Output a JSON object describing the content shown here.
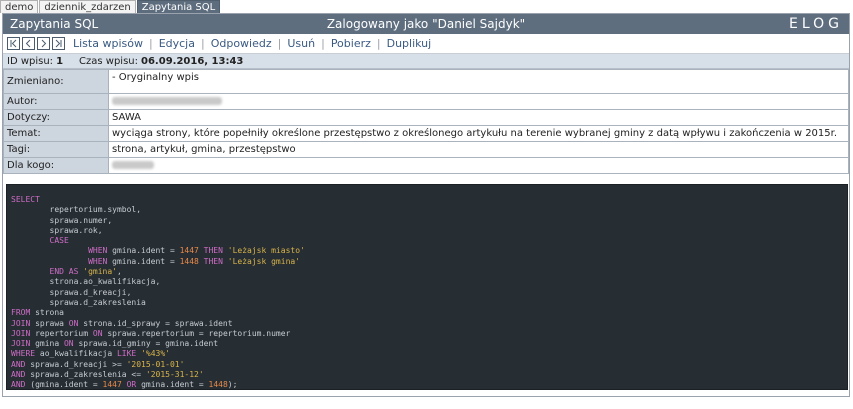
{
  "tabs": [
    {
      "label": "demo",
      "active": false
    },
    {
      "label": "dziennik_zdarzen",
      "active": false
    },
    {
      "label": "Zapytania SQL",
      "active": true
    }
  ],
  "header": {
    "logbook_name": "Zapytania SQL",
    "logged_in": "Zalogowany jako \"Daniel Sajdyk\"",
    "logo": "ELOG"
  },
  "toolbar": {
    "nav_buttons": [
      {
        "name": "first-entry-button",
        "icon": "first-icon"
      },
      {
        "name": "previous-entry-button",
        "icon": "previous-icon"
      },
      {
        "name": "next-entry-button",
        "icon": "next-icon"
      },
      {
        "name": "last-entry-button",
        "icon": "last-icon"
      }
    ],
    "links": [
      "Lista wpisów",
      "Edycja",
      "Odpowiedz",
      "Usuń",
      "Pobierz",
      "Duplikuj"
    ]
  },
  "entry": {
    "id_label": "ID wpisu:",
    "id_value": "1",
    "time_label": "Czas wpisu:",
    "time_value": "06.09.2016, 13:43"
  },
  "attributes": [
    {
      "name": "Zmieniano:",
      "value": "- Oryginalny wpis",
      "redacted": false
    },
    {
      "name": "Autor:",
      "value": "",
      "redacted": true
    },
    {
      "name": "Dotyczy:",
      "value": "SAWA",
      "redacted": false
    },
    {
      "name": "Temat:",
      "value": "wyciąga strony, które popełniły określone przestępstwo z określonego artykułu na terenie wybranej gminy z datą wpływu i zakończenia w 2015r.",
      "redacted": false
    },
    {
      "name": "Tagi:",
      "value": "strona, artykuł, gmina, przestępstwo",
      "redacted": false
    },
    {
      "name": "Dla kogo:",
      "value": "",
      "redacted": true
    }
  ],
  "code": {
    "language": "sql",
    "lines": [
      [
        [
          "kw",
          "SELECT"
        ]
      ],
      [
        [
          "plain",
          "        repertorium.symbol,"
        ]
      ],
      [
        [
          "plain",
          "        sprawa.numer,"
        ]
      ],
      [
        [
          "plain",
          "        sprawa.rok,"
        ]
      ],
      [
        [
          "plain",
          "        "
        ],
        [
          "kw",
          "CASE"
        ]
      ],
      [
        [
          "plain",
          "                "
        ],
        [
          "kw",
          "WHEN"
        ],
        [
          "plain",
          " gmina.ident = "
        ],
        [
          "num",
          "1447"
        ],
        [
          "plain",
          " "
        ],
        [
          "kw",
          "THEN"
        ],
        [
          "plain",
          " "
        ],
        [
          "str",
          "'Leżajsk miasto'"
        ]
      ],
      [
        [
          "plain",
          "                "
        ],
        [
          "kw",
          "WHEN"
        ],
        [
          "plain",
          " gmina.ident = "
        ],
        [
          "num",
          "1448"
        ],
        [
          "plain",
          " "
        ],
        [
          "kw",
          "THEN"
        ],
        [
          "plain",
          " "
        ],
        [
          "str",
          "'Leżajsk gmina'"
        ]
      ],
      [
        [
          "plain",
          "        "
        ],
        [
          "kw",
          "END AS"
        ],
        [
          "plain",
          " "
        ],
        [
          "str",
          "'gmina'"
        ],
        [
          "plain",
          ","
        ]
      ],
      [
        [
          "plain",
          "        strona.ao_kwalifikacja,"
        ]
      ],
      [
        [
          "plain",
          "        sprawa.d_kreacji,"
        ]
      ],
      [
        [
          "plain",
          "        sprawa.d_zakreslenia"
        ]
      ],
      [
        [
          "kw",
          "FROM"
        ],
        [
          "plain",
          " strona"
        ]
      ],
      [
        [
          "kw",
          "JOIN"
        ],
        [
          "plain",
          " sprawa "
        ],
        [
          "kw",
          "ON"
        ],
        [
          "plain",
          " strona.id_sprawy = sprawa.ident"
        ]
      ],
      [
        [
          "kw",
          "JOIN"
        ],
        [
          "plain",
          " repertorium "
        ],
        [
          "kw",
          "ON"
        ],
        [
          "plain",
          " sprawa.repertorium = repertorium.numer"
        ]
      ],
      [
        [
          "kw",
          "JOIN"
        ],
        [
          "plain",
          " gmina "
        ],
        [
          "kw",
          "ON"
        ],
        [
          "plain",
          " sprawa.id_gminy = gmina.ident"
        ]
      ],
      [
        [
          "kw",
          "WHERE"
        ],
        [
          "plain",
          " ao_kwalifikacja "
        ],
        [
          "kw",
          "LIKE"
        ],
        [
          "plain",
          " "
        ],
        [
          "str",
          "'%43%'"
        ]
      ],
      [
        [
          "kw",
          "AND"
        ],
        [
          "plain",
          " sprawa.d_kreacji >= "
        ],
        [
          "str",
          "'2015-01-01'"
        ]
      ],
      [
        [
          "kw",
          "AND"
        ],
        [
          "plain",
          " sprawa.d_zakreslenia <= "
        ],
        [
          "str",
          "'2015-31-12'"
        ]
      ],
      [
        [
          "kw",
          "AND"
        ],
        [
          "plain",
          " (gmina.ident = "
        ],
        [
          "num",
          "1447"
        ],
        [
          "plain",
          " "
        ],
        [
          "kw",
          "OR"
        ],
        [
          "plain",
          " gmina.ident = "
        ],
        [
          "num",
          "1448"
        ],
        [
          "plain",
          ");"
        ]
      ]
    ]
  }
}
